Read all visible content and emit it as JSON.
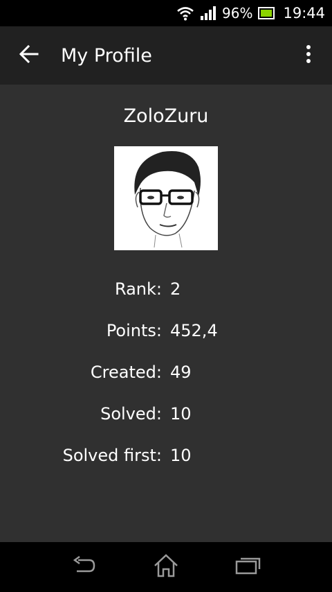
{
  "status_bar": {
    "battery_percent": "96%",
    "time": "19:44",
    "icons": [
      "wifi-icon",
      "signal-icon",
      "battery-icon"
    ]
  },
  "app_bar": {
    "title": "My Profile",
    "back_icon": "arrow-left-icon",
    "menu_icon": "more-vert-icon"
  },
  "profile": {
    "username": "ZoloZuru",
    "stats": [
      {
        "label": "Rank:",
        "value": "2"
      },
      {
        "label": "Points:",
        "value": "452,4"
      },
      {
        "label": "Created:",
        "value": "49"
      },
      {
        "label": "Solved:",
        "value": "10"
      },
      {
        "label": "Solved first:",
        "value": "10"
      }
    ]
  },
  "nav_bar": {
    "icons": [
      "back-icon",
      "home-icon",
      "recents-icon"
    ]
  },
  "colors": {
    "background": "#303030",
    "app_bar": "#212121",
    "status_bar": "#000000",
    "battery_fill": "#8bd300"
  }
}
